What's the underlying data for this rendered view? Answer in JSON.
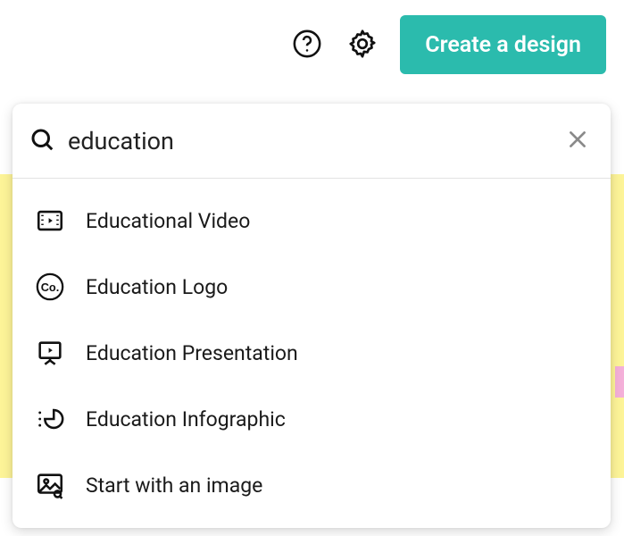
{
  "colors": {
    "accent": "#2bbbad"
  },
  "topbar": {
    "help_icon": "help-icon",
    "settings_icon": "gear-icon",
    "create_label": "Create a design"
  },
  "search": {
    "value": "education",
    "placeholder": "",
    "clear_icon": "close-icon",
    "results": [
      {
        "label": "Educational Video",
        "icon": "video-icon"
      },
      {
        "label": "Education Logo",
        "icon": "logo-icon"
      },
      {
        "label": "Education Presentation",
        "icon": "presentation-icon"
      },
      {
        "label": "Education Infographic",
        "icon": "infographic-icon"
      },
      {
        "label": "Start with an image",
        "icon": "image-icon"
      }
    ]
  }
}
